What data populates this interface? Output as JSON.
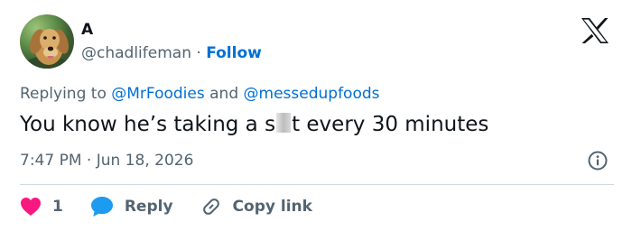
{
  "author": {
    "name": "A",
    "handle": "@chadlifeman",
    "separator": "·",
    "follow_label": "Follow"
  },
  "reply_context": {
    "prefix": "Replying to",
    "first_mention": "@MrFoodies",
    "joiner": "and",
    "second_mention": "@messedupfoods"
  },
  "tweet": {
    "text_before_censor": "You know he’s taking a s",
    "text_after_censor": "t every 30 minutes"
  },
  "meta": {
    "time": "7:47 PM",
    "separator": "·",
    "date": "Jun 18, 2026"
  },
  "actions": {
    "like_count": "1",
    "reply_label": "Reply",
    "copy_link_label": "Copy link"
  },
  "colors": {
    "link_blue": "#006fd6",
    "muted_gray": "#536471",
    "heart_pink": "#f91880",
    "reply_bubble_blue": "#1d9bf0",
    "text_dark": "#0f1419"
  },
  "icons": {
    "brand": "x-logo-icon",
    "info": "info-icon",
    "like": "heart-icon",
    "reply": "speech-bubble-icon",
    "copy_link": "link-icon"
  }
}
